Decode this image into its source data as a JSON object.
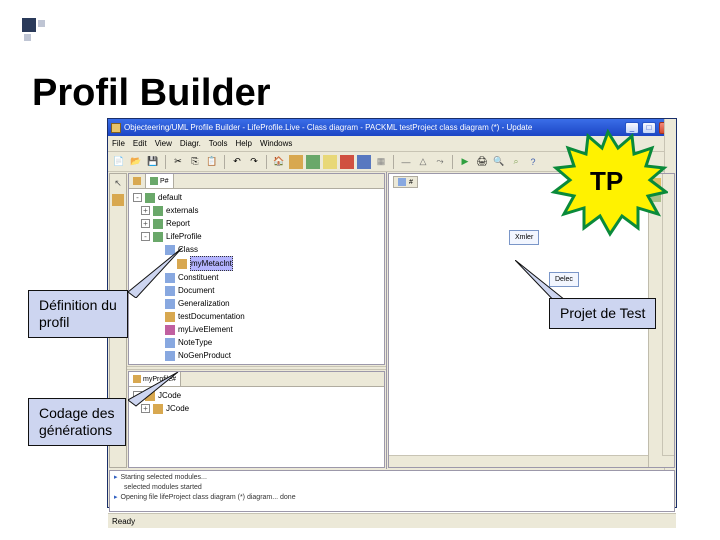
{
  "slide": {
    "title": "Profil Builder"
  },
  "callouts": {
    "definition": "Définition du\nprofil",
    "codage": "Codage des\ngénérations",
    "projet": "Projet de Test",
    "tp": "TP"
  },
  "window": {
    "title": "Objecteering/UML Profile Builder - LifeProfile.Live - Class diagram - PACKML testProject class diagram (*) - Update",
    "menus": [
      "File",
      "Edit",
      "View",
      "Diagr.",
      "Tools",
      "Help",
      "Windows"
    ],
    "status_left": "Ready",
    "status_right": ""
  },
  "tree_top": {
    "tab1": "P#",
    "tab2": "",
    "root": "default",
    "items": [
      {
        "label": "externals",
        "indent": 1,
        "exp": "+",
        "color": "#6aa86a"
      },
      {
        "label": "Report",
        "indent": 1,
        "exp": "+",
        "color": "#6aa86a"
      },
      {
        "label": "LifeProfile",
        "indent": 1,
        "exp": "-",
        "color": "#6aa86a"
      },
      {
        "label": "Class",
        "indent": 2,
        "exp": "",
        "color": "#88a8e0"
      },
      {
        "label": "myMetaclnt",
        "indent": 3,
        "exp": "",
        "color": "#d8a850",
        "selected": true
      },
      {
        "label": "Constituent",
        "indent": 2,
        "exp": "",
        "color": "#88a8e0"
      },
      {
        "label": "Document",
        "indent": 2,
        "exp": "",
        "color": "#88a8e0"
      },
      {
        "label": "Generalization",
        "indent": 2,
        "exp": "",
        "color": "#88a8e0"
      },
      {
        "label": "testDocumentation",
        "indent": 2,
        "exp": "",
        "color": "#d8a850"
      },
      {
        "label": "myLiveElement",
        "indent": 2,
        "exp": "",
        "color": "#c060a0"
      },
      {
        "label": "NoteType",
        "indent": 2,
        "exp": "",
        "color": "#88a8e0"
      },
      {
        "label": "NoGenProduct",
        "indent": 2,
        "exp": "",
        "color": "#88a8e0"
      }
    ]
  },
  "tree_bottom": {
    "tab1": "myProfile#",
    "root": "JCode",
    "items": [
      {
        "label": "JCode",
        "indent": 1,
        "exp": "+",
        "color": "#d8a850"
      }
    ]
  },
  "diagram": {
    "tab": "#",
    "node1": "Xmler",
    "node2": "Delec"
  },
  "log": {
    "line1": "Starting selected modules...",
    "line2": "selected modules started",
    "line3": "Opening file lifeProject class diagram (*) diagram... done"
  },
  "toolbar_colors": {
    "new": "#f0e4b0",
    "open": "#e0c068",
    "save": "#5878c0",
    "copy": "#c8a0d8",
    "paste": "#a8c8a0",
    "undo": "#5090c0",
    "redo": "#5090c0",
    "run": "#30a040",
    "stop": "#c04040",
    "zoom": "#888",
    "doc": "#e8e0a8",
    "print": "#7090c8",
    "find": "#88a860",
    "help": "#4060b0",
    "cfg": "#a8a868",
    "cls": "#d8a850",
    "pkg": "#6aa86a",
    "note": "#e8d878",
    "assoc": "#8888b0",
    "gen": "#8888b0"
  }
}
